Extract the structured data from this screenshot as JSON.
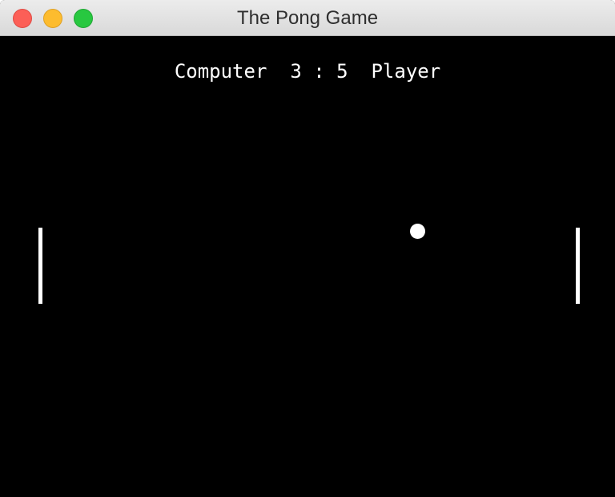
{
  "window": {
    "title": "The Pong Game"
  },
  "scoreboard": {
    "left_label": "Computer",
    "left_score": "3",
    "separator": ":",
    "right_score": "5",
    "right_label": "Player"
  },
  "colors": {
    "background": "#000000",
    "foreground": "#ffffff",
    "close_button": "#fc5f57",
    "minimize_button": "#fdbc2e",
    "zoom_button": "#28c840"
  }
}
